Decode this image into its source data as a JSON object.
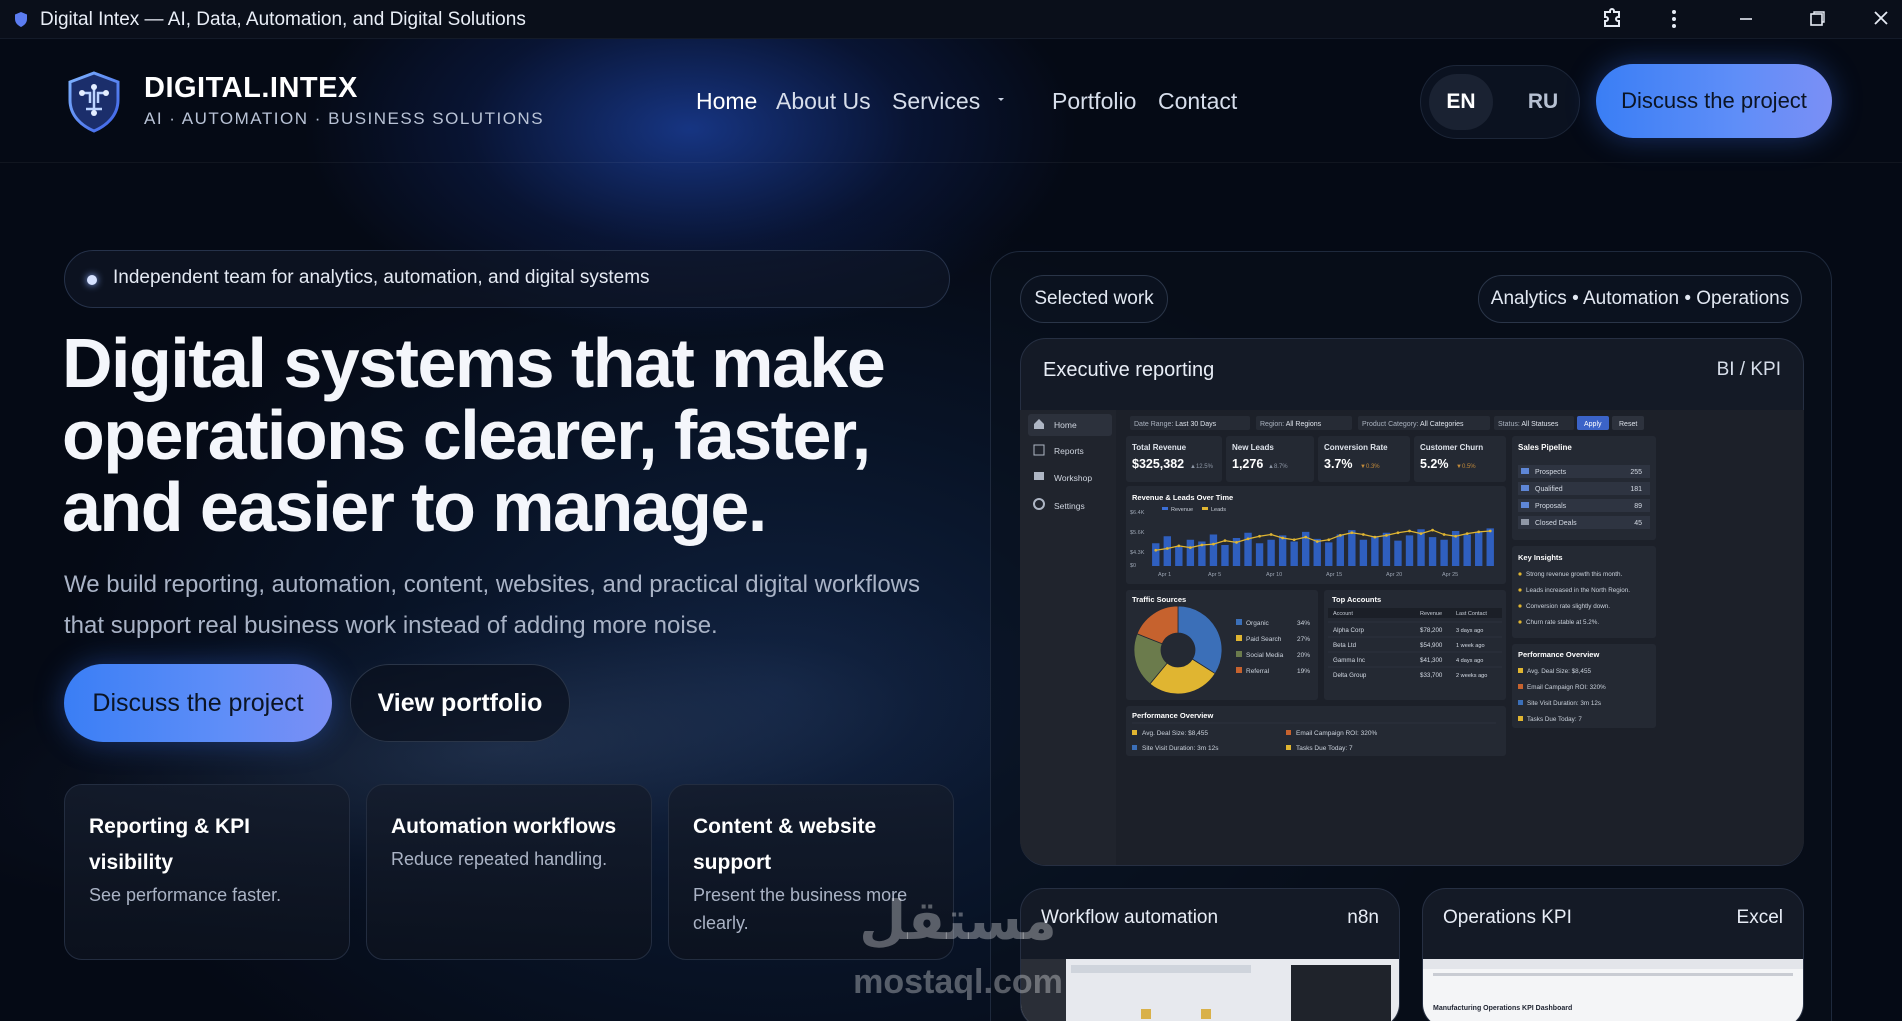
{
  "titlebar": {
    "title": "Digital Intex — AI, Data, Automation, and Digital Solutions",
    "icons": [
      "shield-icon",
      "extensions-icon",
      "more-vertical-icon",
      "minimize-icon",
      "maximize-icon",
      "close-icon"
    ]
  },
  "header": {
    "logo_name": "DIGITAL.INTEX",
    "logo_tagline": "AI · AUTOMATION · BUSINESS SOLUTIONS",
    "nav": [
      "Home",
      "About Us",
      "Services",
      "Portfolio",
      "Contact"
    ],
    "active_nav": "Home",
    "lang_en": "EN",
    "lang_ru": "RU",
    "cta": "Discuss the project"
  },
  "hero": {
    "badge": "Independent team for analytics, automation, and digital systems",
    "title": "Digital systems that make operations clearer, faster, and easier to manage.",
    "subtitle": "We build reporting, automation, content, websites, and practical digital workflows that support real business work instead of adding more noise.",
    "cta_primary": "Discuss the project",
    "cta_secondary": "View portfolio"
  },
  "features": [
    {
      "title": "Reporting & KPI visibility",
      "desc": "See performance faster."
    },
    {
      "title": "Automation workflows",
      "desc": "Reduce repeated handling."
    },
    {
      "title": "Content & website support",
      "desc": "Present the business more clearly."
    }
  ],
  "watermark": {
    "arabic": "مستقل",
    "latin": "mostaql.com"
  },
  "panel": {
    "chip_left": "Selected work",
    "chip_right": "Analytics • Automation • Operations",
    "exec_title": "Executive reporting",
    "exec_tag": "BI / KPI"
  },
  "dashboard": {
    "sidebar": [
      "Home",
      "Reports",
      "Workshop",
      "Settings"
    ],
    "filters": [
      {
        "label": "Date Range:",
        "value": "Last 30 Days"
      },
      {
        "label": "Region:",
        "value": "All Regions"
      },
      {
        "label": "Product Category:",
        "value": "All Categories"
      },
      {
        "label": "Status:",
        "value": "All Statuses"
      }
    ],
    "apply": "Apply",
    "reset": "Reset",
    "kpis": [
      {
        "label": "Total Revenue",
        "value": "$325,382",
        "delta": "▲12.5%"
      },
      {
        "label": "New Leads",
        "value": "1,276",
        "delta": "▲8.7%"
      },
      {
        "label": "Conversion Rate",
        "value": "3.7%",
        "delta": "▼0.3%"
      },
      {
        "label": "Customer Churn",
        "value": "5.2%",
        "delta": "▼0.5%"
      }
    ],
    "pipeline_title": "Sales Pipeline",
    "pipeline": [
      {
        "label": "Prospects",
        "value": "255"
      },
      {
        "label": "Qualified",
        "value": "181"
      },
      {
        "label": "Proposals",
        "value": "89"
      },
      {
        "label": "Closed Deals",
        "value": "45"
      }
    ],
    "chart_title": "Revenue & Leads Over Time",
    "legend": [
      "Revenue",
      "Leads"
    ],
    "y_ticks": [
      "$6.4K",
      "$5.6K",
      "$4.3K",
      "$0"
    ],
    "x_ticks": [
      "Apr 1",
      "Apr 5",
      "Apr 10",
      "Apr 15",
      "Apr 20",
      "Apr 25"
    ],
    "insights_title": "Key Insights",
    "insights": [
      "Strong revenue growth this month.",
      "Leads increased in the North Region.",
      "Conversion rate slightly down.",
      "Churn rate stable at 5.2%."
    ],
    "traffic_title": "Traffic Sources",
    "traffic": [
      {
        "label": "Organic",
        "value": "34%",
        "color": "#3b6fb8"
      },
      {
        "label": "Paid Search",
        "value": "27%",
        "color": "#e0b531"
      },
      {
        "label": "Social Media",
        "value": "20%",
        "color": "#6b7b4c"
      },
      {
        "label": "Referral",
        "value": "19%",
        "color": "#c6622e"
      }
    ],
    "accounts_title": "Top Accounts",
    "accounts_headers": [
      "Account",
      "Revenue",
      "Last Contact"
    ],
    "accounts": [
      [
        "Alpha Corp",
        "$78,200",
        "3 days ago"
      ],
      [
        "Beta Ltd",
        "$54,900",
        "1 week ago"
      ],
      [
        "Gamma Inc",
        "$41,300",
        "4 days ago"
      ],
      [
        "Delta Group",
        "$33,700",
        "2 weeks ago"
      ]
    ],
    "perf_title": "Performance Overview",
    "perf": [
      "Avg. Deal Size: $8,455",
      "Email Campaign ROI: 320%",
      "Site Visit Duration: 3m 12s",
      "Tasks Due Today: 7"
    ],
    "perf_bottom_title": "Performance Overview",
    "perf_bottom": [
      "Avg. Deal Size: $8,455",
      "Email Campaign ROI: 320%",
      "Site Visit Duration: 3m 12s",
      "Tasks Due Today: 7"
    ]
  },
  "bottom_cards": [
    {
      "title": "Workflow automation",
      "tag": "n8n"
    },
    {
      "title": "Operations KPI",
      "tag": "Excel",
      "doc_title": "Manufacturing Operations KPI Dashboard"
    }
  ],
  "chart_data": {
    "type": "bar",
    "title": "Revenue & Leads Over Time",
    "categories": [
      "Apr 1",
      "Apr 2",
      "Apr 3",
      "Apr 4",
      "Apr 5",
      "Apr 6",
      "Apr 7",
      "Apr 8",
      "Apr 9",
      "Apr 10",
      "Apr 11",
      "Apr 12",
      "Apr 13",
      "Apr 14",
      "Apr 15",
      "Apr 16",
      "Apr 17",
      "Apr 18",
      "Apr 19",
      "Apr 20",
      "Apr 21",
      "Apr 22",
      "Apr 23",
      "Apr 24",
      "Apr 25",
      "Apr 26",
      "Apr 27",
      "Apr 28",
      "Apr 29",
      "Apr 30"
    ],
    "series": [
      {
        "name": "Revenue",
        "type": "bar",
        "values": [
          2.6,
          3.4,
          2.2,
          3.0,
          2.8,
          3.6,
          2.4,
          3.2,
          3.8,
          2.6,
          3.0,
          3.5,
          2.8,
          3.9,
          3.1,
          2.7,
          3.6,
          4.1,
          3.0,
          3.4,
          3.8,
          2.9,
          3.5,
          4.2,
          3.3,
          3.0,
          4.0,
          3.6,
          3.9,
          4.3
        ]
      },
      {
        "name": "Leads",
        "type": "line",
        "values": [
          1.8,
          2.0,
          2.3,
          2.1,
          2.4,
          2.5,
          2.9,
          2.7,
          3.1,
          3.4,
          3.6,
          3.2,
          3.0,
          3.3,
          2.8,
          3.0,
          3.5,
          3.8,
          3.6,
          3.3,
          3.5,
          3.8,
          4.0,
          3.7,
          4.1,
          3.6,
          3.4,
          3.7,
          3.9,
          4.0
        ]
      }
    ],
    "ylim": [
      0,
      6.4
    ],
    "y_ticks": [
      "$6.4K",
      "$5.6K",
      "$4.3K",
      "$0"
    ],
    "legend": "top-left"
  }
}
